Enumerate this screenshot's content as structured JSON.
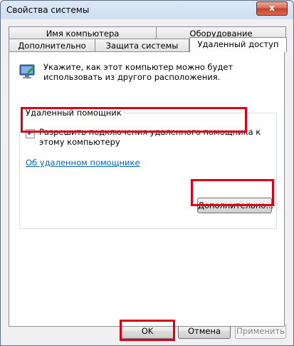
{
  "window": {
    "title": "Свойства системы",
    "close_glyph": "x"
  },
  "tabs_row1": [
    {
      "label": "Имя компьютера"
    },
    {
      "label": "Оборудование"
    }
  ],
  "tabs_row2": [
    {
      "label": "Дополнительно"
    },
    {
      "label": "Защита системы"
    },
    {
      "label": "Удаленный доступ",
      "active": true
    }
  ],
  "info": {
    "text": "Укажите, как этот компьютер можно будет использовать из другого расположения.",
    "icon": "remote-desktop-icon"
  },
  "remote_assistance": {
    "title": "Удаленный помощник",
    "checkbox_label": "Разрешить подключения удаленного помощника к этому компьютеру",
    "checked": true,
    "link": "Об удаленном помощнике",
    "advanced_button": "Дополнительно..."
  },
  "footer": {
    "ok": "OK",
    "cancel": "Отмена",
    "apply": "Применить"
  },
  "colors": {
    "highlight": "#d9001b",
    "link": "#0066cc"
  }
}
